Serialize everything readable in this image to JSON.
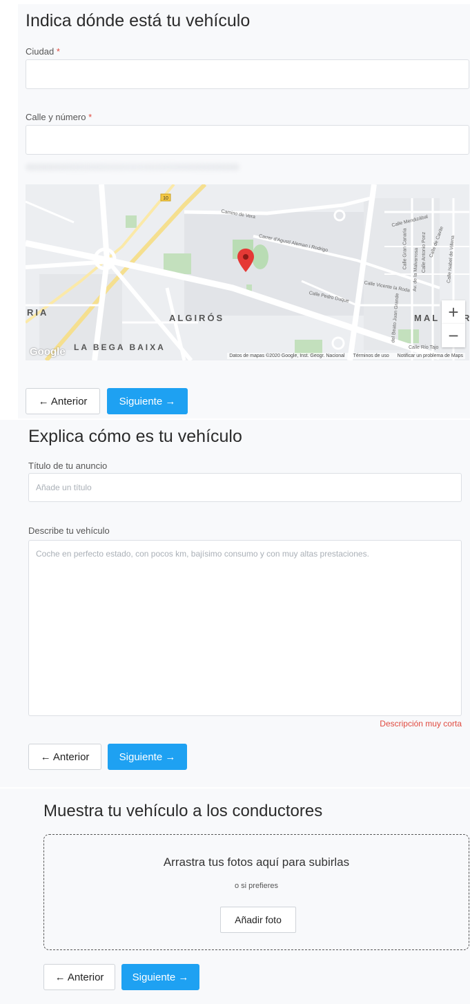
{
  "location": {
    "title": "Indica dónde está tu vehículo",
    "city_label": "Ciudad",
    "city_required": "*",
    "city_value": "",
    "street_label": "Calle y número",
    "street_required": "*",
    "street_value": "",
    "map": {
      "district_labels": [
        "ALGIRÓS",
        "LA BEGA BAIXA",
        "RIA",
        "MAL",
        "R"
      ],
      "street_labels": [
        "Camino de Vera",
        "Carrer d'Agustí Aleman i Rodrigo",
        "Calle Vicente la Roda",
        "Calle Pedro Duque",
        "Calle Mendizábal",
        "Calle Gran Canaria",
        "Calle Antonio Ponz",
        "Calle de Cavite",
        "Calle Isabel de Villena",
        "Av. de la Malvarrosa",
        "Calle Río Tajo",
        "del Beato Juan Grande"
      ],
      "road_shield": "10",
      "zoom_in": "+",
      "zoom_out": "−",
      "google_logo": "Google",
      "attribution": "Datos de mapas ©2020 Google, Inst. Geogr. Nacional",
      "terms": "Términos de uso",
      "report": "Notificar un problema de Maps"
    },
    "prev": "← Anterior",
    "next": "Siguiente →"
  },
  "description": {
    "title": "Explica cómo es tu vehículo",
    "title_label": "Título de tu anuncio",
    "title_placeholder": "Añade un título",
    "desc_label": "Describe tu vehículo",
    "desc_placeholder": "Coche en perfecto estado, con pocos km, bajísimo consumo y con muy altas prestaciones.",
    "error": "Descripción muy corta",
    "prev": "← Anterior",
    "next": "Siguiente →"
  },
  "photos": {
    "title": "Muestra tu vehículo a los conductores",
    "drop_text": "Arrastra tus fotos aquí para subirlas",
    "or_text": "o si prefieres",
    "add_button": "Añadir foto",
    "prev": "← Anterior",
    "next": "Siguiente →"
  },
  "colors": {
    "primary": "#1ea1f2",
    "error": "#e04a3f",
    "marker": "#e53935"
  },
  "icons": [
    "map-marker-icon",
    "zoom-in-icon",
    "zoom-out-icon"
  ]
}
